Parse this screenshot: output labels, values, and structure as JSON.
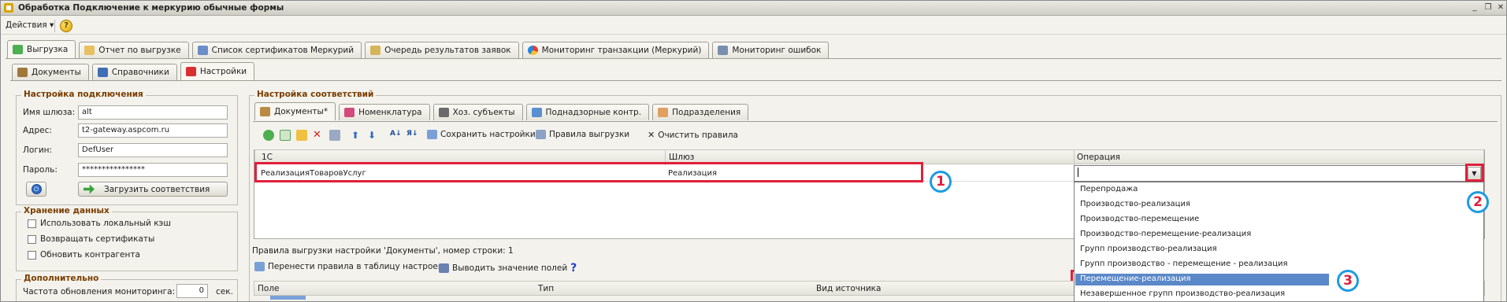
{
  "window": {
    "title": "Обработка  Подключение к меркурию обычные формы"
  },
  "menu": {
    "actions_label": "Действия",
    "help_label": "?"
  },
  "main_tabs": [
    {
      "label": "Выгрузка",
      "active": true
    },
    {
      "label": "Отчет по выгрузке"
    },
    {
      "label": "Список сертификатов Меркурий"
    },
    {
      "label": "Очередь результатов заявок"
    },
    {
      "label": "Мониторинг транзакции (Меркурий)"
    },
    {
      "label": "Мониторинг ошибок"
    }
  ],
  "sub_tabs": [
    {
      "label": "Документы"
    },
    {
      "label": "Справочники"
    },
    {
      "label": "Настройки",
      "active": true
    }
  ],
  "connection": {
    "title": "Настройка подключения",
    "gateway_label": "Имя шлюза:",
    "gateway_value": "alt",
    "address_label": "Адрес:",
    "address_value": "t2-gateway.aspcom.ru",
    "login_label": "Логин:",
    "login_value": "DefUser",
    "password_label": "Пароль:",
    "password_value": "****************",
    "load_button": "Загрузить соответствия"
  },
  "storage": {
    "title": "Хранение данных",
    "options": [
      "Использовать локальный кэш",
      "Возвращать сертификаты",
      "Обновить контрагента"
    ]
  },
  "extra": {
    "title": "Дополнительно",
    "refresh_label": "Частота обновления мониторинга:",
    "refresh_value": "0",
    "refresh_unit": "сек."
  },
  "mapping": {
    "title": "Настройка соответствий",
    "tabs": [
      {
        "label": "Документы*",
        "active": true
      },
      {
        "label": "Номенклатура"
      },
      {
        "label": "Хоз. субъекты"
      },
      {
        "label": "Поднадзорные контр."
      },
      {
        "label": "Подразделения"
      }
    ],
    "toolbar": {
      "save_settings": "Сохранить настройки",
      "export_rules": "Правила выгрузки",
      "clear_rules": "Очистить правила"
    },
    "columns": [
      "1С",
      "Шлюз",
      "Операция"
    ],
    "row": {
      "c1": "РеализацияТоваровУслуг",
      "gateway": "Реализация",
      "operation": ""
    },
    "rules_caption": "Правила выгрузки настройки 'Документы', номер строки: 1",
    "rules_toolbar": {
      "transfer": "Перенести правила в таблицу настроек",
      "show_fields": "Выводить значение полей"
    },
    "rules_columns": [
      "Поле",
      "Тип",
      "Вид источника"
    ]
  },
  "dropdown": {
    "options": [
      "Перепродажа",
      "Производство-реализация",
      "Производство-перемещение",
      "Производство-перемещение-реализация",
      "Групп производство-реализация",
      "Групп производство - перемещение - реализация",
      "Перемещение-реализация",
      "Незавершенное групп производство-реализация"
    ],
    "selected_index": 6
  },
  "callouts": [
    "1",
    "2",
    "3"
  ],
  "colors": {
    "highlight": "#e0203a",
    "callout_ring": "#1e9be0",
    "selection": "#5b88c8"
  }
}
